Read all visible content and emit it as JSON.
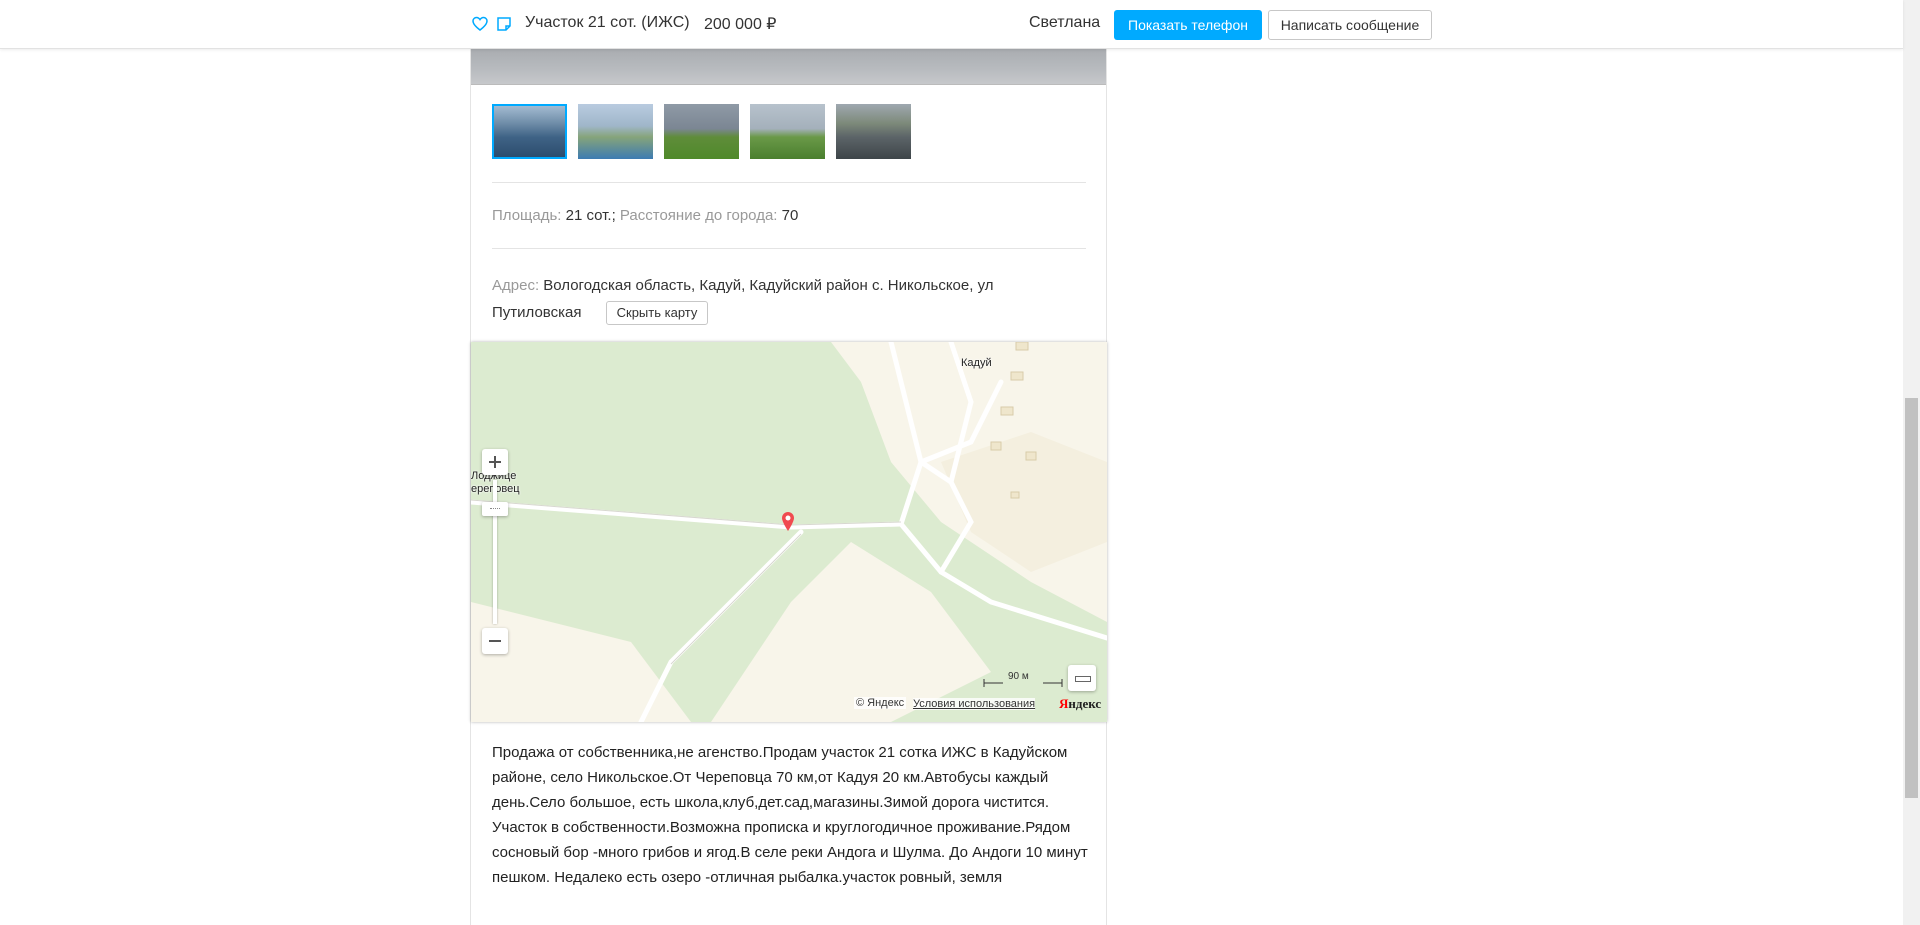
{
  "topbar": {
    "title": "Участок 21 сот. (ИЖС)",
    "price": "200 000  ₽",
    "seller": "Светлана",
    "show_phone": "Показать телефон",
    "write_message": "Написать сообщение",
    "icons": [
      "heart-icon",
      "note-icon"
    ]
  },
  "params": {
    "area_label": "Площадь:",
    "area_value": "21 сот.",
    "separator": ";",
    "distance_label": "Расстояние до города:",
    "distance_value": "70"
  },
  "address": {
    "label": "Адрес:",
    "value": "Вологодская область, Кадуй, Кадуйский район с. Никольское, ул Путиловская",
    "hide_map": "Скрыть карту"
  },
  "map": {
    "label_town": "Кадуй",
    "label_city_line1": "Лоджице",
    "label_city_line2": "ереповец",
    "scale": "90 м",
    "copyright": "© Яндекс",
    "terms": "Условия использования",
    "logo_ya": "Я",
    "logo_rest": "ндекс"
  },
  "description": "Продажа от собственника,не агенство.Продам участок 21 сотка ИЖС в Кадуйском районе, село Никольское.От Череповца 70 км,от Кадуя 20 км.Автобусы каждый день.Село большое, есть школа,клуб,дет.сад,магазины.Зимой дорога чистится. Участок в собственности.Возможна прописка и круглогодичное проживание.Рядом сосновый бор -много грибов и ягод.В селе реки Андога и Шулма. До Андоги 10 минут пешком. Недалеко есть озеро -отличная рыбалка.участок ровный, земля"
}
